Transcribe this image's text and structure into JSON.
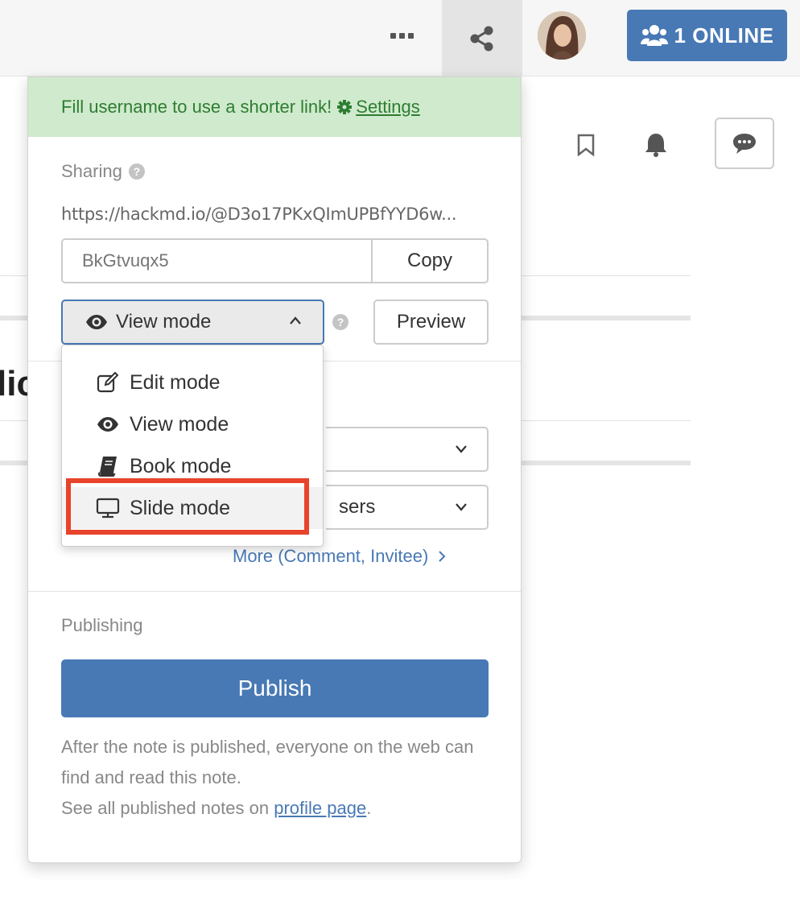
{
  "topbar": {
    "online_label": "1 ONLINE",
    "icons": [
      "more-icon",
      "share-icon",
      "users-icon"
    ]
  },
  "background": {
    "title_fragment": "lic",
    "icons": [
      "bookmark-icon",
      "bell-icon",
      "comment-icon"
    ]
  },
  "share_panel": {
    "alert": {
      "text": "Fill username to use a shorter link!",
      "settings_label": "Settings"
    },
    "sharing": {
      "label": "Sharing",
      "url": "https://hackmd.io/@D3o17PKxQImUPBfYYD6w...",
      "link_placeholder": "BkGtvuqx5",
      "copy_label": "Copy",
      "mode_selected": "View mode",
      "preview_label": "Preview"
    },
    "permissions": {
      "visible_option_fragment": "sers",
      "more_link": "More (Comment, Invitee)"
    },
    "publishing": {
      "label": "Publishing",
      "publish_label": "Publish",
      "desc_line1": "After the note is published, everyone on the web can find and read this note.",
      "desc_line2_prefix": "See all published notes on ",
      "profile_link": "profile page",
      "desc_line2_suffix": "."
    }
  },
  "mode_menu": {
    "items": [
      {
        "label": "Edit mode",
        "icon": "edit-icon"
      },
      {
        "label": "View mode",
        "icon": "eye-icon"
      },
      {
        "label": "Book mode",
        "icon": "book-icon"
      },
      {
        "label": "Slide mode",
        "icon": "monitor-icon"
      }
    ],
    "highlighted": "Slide mode"
  },
  "colors": {
    "accent": "#4879b5",
    "alert_bg": "#cfeacc",
    "alert_text": "#2e7d32",
    "highlight": "#e8432b"
  }
}
